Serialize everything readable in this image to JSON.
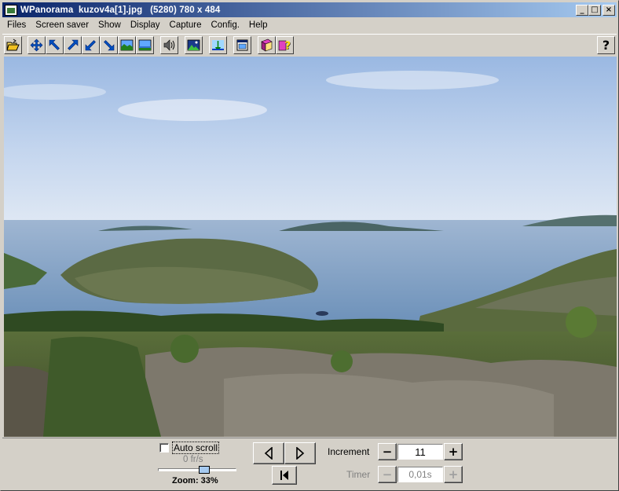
{
  "window": {
    "title": "WPanorama  kuzov4a[1].jpg   (5280) 780 x 484",
    "minimize": "_",
    "maximize": "□",
    "close": "×"
  },
  "menu": {
    "items": [
      "Files",
      "Screen saver",
      "Show",
      "Display",
      "Capture",
      "Config.",
      "Help"
    ]
  },
  "toolbar": {
    "help_label": "?",
    "icons": [
      "open-file-icon",
      "move-all-icon",
      "arrow-up-left-icon",
      "arrow-up-right-icon",
      "arrow-down-left-icon",
      "arrow-down-right-icon",
      "panorama-up-icon",
      "panorama-down-icon",
      "sound-icon",
      "landscape-icon",
      "sea-scene-icon",
      "fit-window-icon",
      "book-icon",
      "help-book-icon"
    ]
  },
  "controls": {
    "auto_scroll_label": "Auto scroll",
    "auto_scroll_checked": false,
    "fps_text": "0 fr/s",
    "zoom_text": "Zoom: 33%",
    "zoom_slider_fraction": 0.6,
    "increment_label": "Increment",
    "increment_value": "11",
    "timer_label": "Timer",
    "timer_value": "0,01s"
  },
  "colors": {
    "titlebar_start": "#0a246a",
    "titlebar_end": "#a6caf0",
    "face": "#d4d0c8"
  }
}
